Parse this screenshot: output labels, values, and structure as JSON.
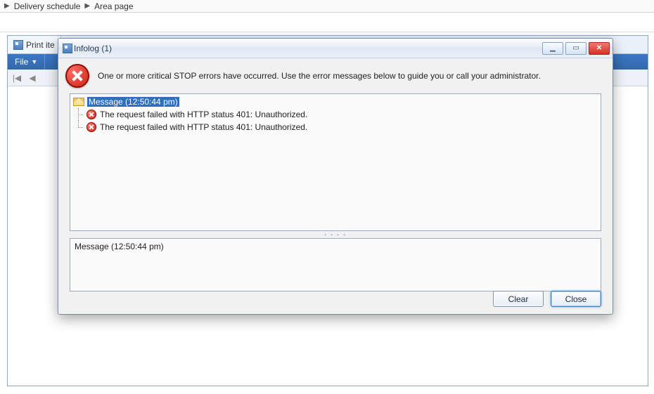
{
  "breadcrumb": {
    "items": [
      "Delivery schedule",
      "Area page"
    ]
  },
  "bg_window": {
    "tab_label": "Print ite",
    "menu_file": "File",
    "nav_first": "|◀",
    "nav_prev": "◀"
  },
  "dialog": {
    "title": "Infolog (1)",
    "header_text": "One or more critical STOP errors have occurred. Use the error messages below to guide you or call your administrator.",
    "tree": {
      "root_label": "Message (12:50:44 pm)",
      "items": [
        "The request failed with HTTP status 401: Unauthorized.",
        "The request failed with HTTP status 401: Unauthorized."
      ]
    },
    "detail_text": "Message (12:50:44 pm)",
    "buttons": {
      "clear": "Clear",
      "close": "Close"
    },
    "winbtn": {
      "min": "▁",
      "max": "▭",
      "close": "✕"
    }
  }
}
